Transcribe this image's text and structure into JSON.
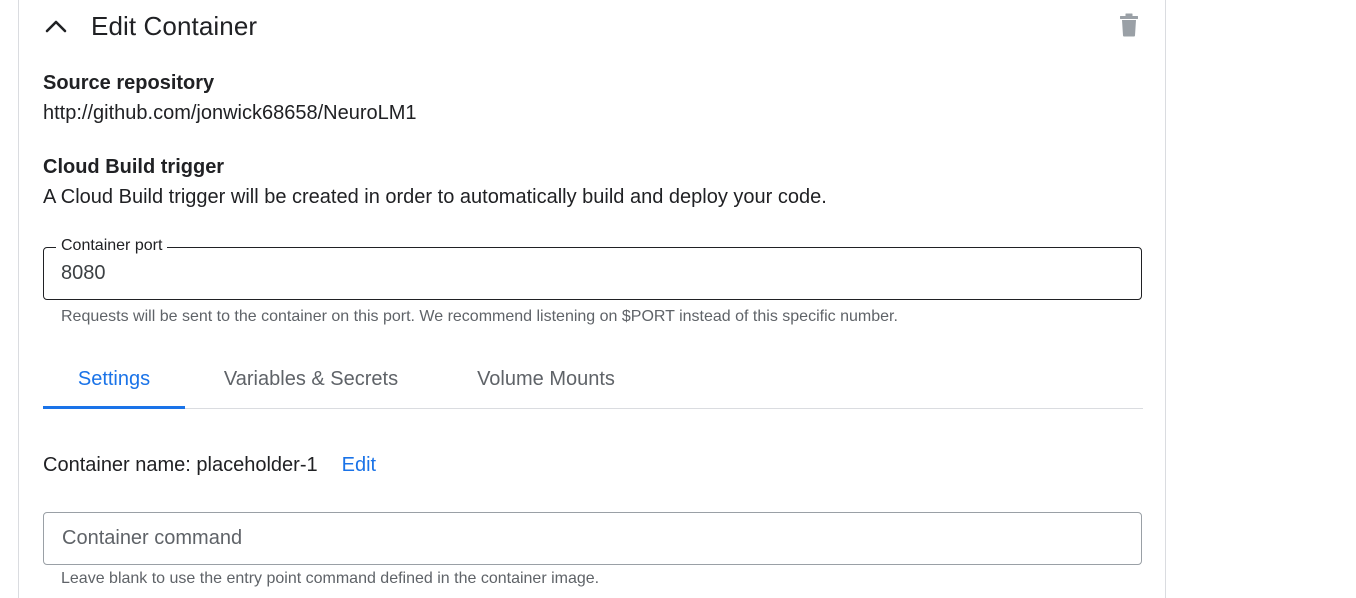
{
  "header": {
    "title": "Edit Container",
    "collapse_icon": "chevron-up-icon",
    "delete_icon": "trash-icon"
  },
  "source": {
    "label": "Source repository",
    "value": "http://github.com/jonwick68658/NeuroLM1"
  },
  "cloud_build": {
    "label": "Cloud Build trigger",
    "description": "A Cloud Build trigger will be created in order to automatically build and deploy your code."
  },
  "port": {
    "label": "Container port",
    "value": "8080",
    "helper": "Requests will be sent to the container on this port. We recommend listening on $PORT instead of this specific number."
  },
  "tabs": [
    {
      "label": "Settings",
      "active": true
    },
    {
      "label": "Variables & Secrets",
      "active": false
    },
    {
      "label": "Volume Mounts",
      "active": false
    }
  ],
  "container_name": {
    "text": "Container name: placeholder-1",
    "edit_label": "Edit"
  },
  "command": {
    "placeholder": "Container command",
    "helper": "Leave blank to use the entry point command defined in the container image."
  },
  "colors": {
    "accent": "#1a73e8",
    "text": "#202124",
    "muted": "#5f6368",
    "border": "#dadce0"
  }
}
